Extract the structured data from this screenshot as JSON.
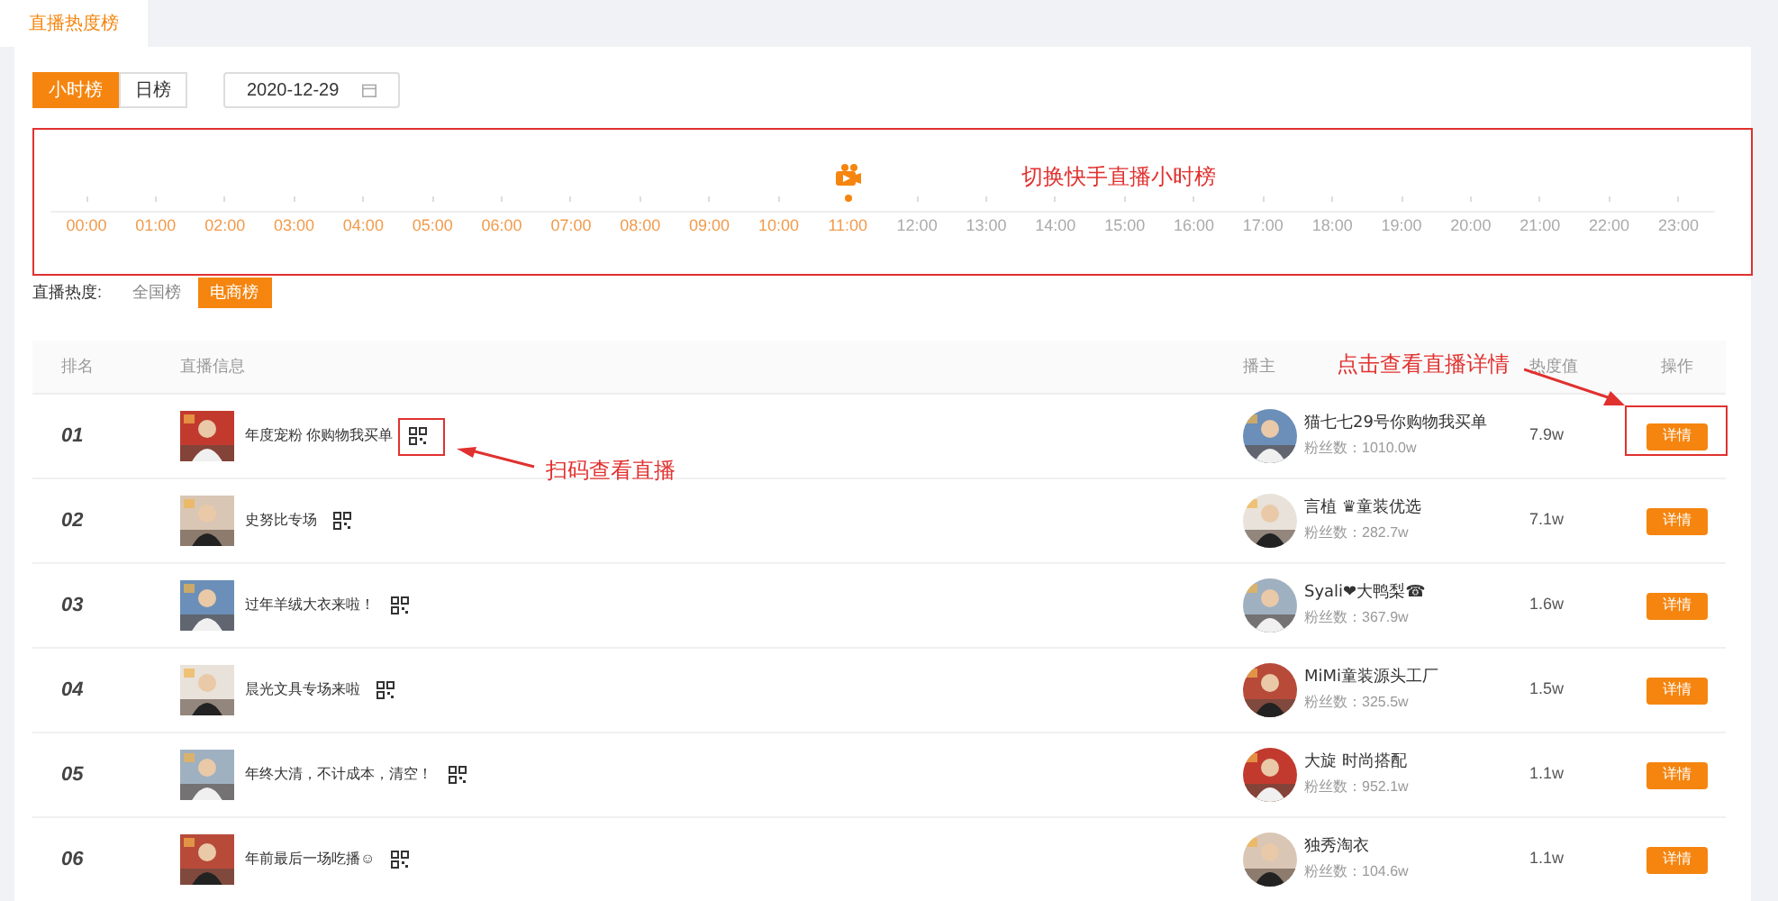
{
  "page_tab": {
    "label": "直播热度榜",
    "selected": true
  },
  "period_tabs": [
    {
      "label": "小时榜",
      "selected": true
    },
    {
      "label": "日榜",
      "selected": false
    }
  ],
  "date_field": {
    "value": "2020-12-29"
  },
  "timeline": [
    {
      "label": "00:00",
      "available": true,
      "selected": false
    },
    {
      "label": "01:00",
      "available": true,
      "selected": false
    },
    {
      "label": "02:00",
      "available": true,
      "selected": false
    },
    {
      "label": "03:00",
      "available": true,
      "selected": false
    },
    {
      "label": "04:00",
      "available": true,
      "selected": false
    },
    {
      "label": "05:00",
      "available": true,
      "selected": false
    },
    {
      "label": "06:00",
      "available": true,
      "selected": false
    },
    {
      "label": "07:00",
      "available": true,
      "selected": false
    },
    {
      "label": "08:00",
      "available": true,
      "selected": false
    },
    {
      "label": "09:00",
      "available": true,
      "selected": false
    },
    {
      "label": "10:00",
      "available": true,
      "selected": false
    },
    {
      "label": "11:00",
      "available": true,
      "selected": true
    },
    {
      "label": "12:00",
      "available": false,
      "selected": false
    },
    {
      "label": "13:00",
      "available": false,
      "selected": false
    },
    {
      "label": "14:00",
      "available": false,
      "selected": false
    },
    {
      "label": "15:00",
      "available": false,
      "selected": false
    },
    {
      "label": "16:00",
      "available": false,
      "selected": false
    },
    {
      "label": "17:00",
      "available": false,
      "selected": false
    },
    {
      "label": "18:00",
      "available": false,
      "selected": false
    },
    {
      "label": "19:00",
      "available": false,
      "selected": false
    },
    {
      "label": "20:00",
      "available": false,
      "selected": false
    },
    {
      "label": "21:00",
      "available": false,
      "selected": false
    },
    {
      "label": "22:00",
      "available": false,
      "selected": false
    },
    {
      "label": "23:00",
      "available": false,
      "selected": false
    }
  ],
  "heat_filter": {
    "label": "直播热度:",
    "options": [
      {
        "label": "全国榜",
        "selected": false
      },
      {
        "label": "电商榜",
        "selected": true
      }
    ]
  },
  "table": {
    "columns": [
      "排名",
      "直播信息",
      "播主",
      "热度值",
      "操作"
    ],
    "rows": [
      {
        "rank": "01",
        "title": "年度宠粉 你购物我买单",
        "anchor": "猫七七29号你购物我买单",
        "fans": "粉丝数：1010.0w",
        "heat": "7.9w",
        "action": "详情"
      },
      {
        "rank": "02",
        "title": "史努比专场",
        "anchor": "言植 ♛童装优选",
        "fans": "粉丝数：282.7w",
        "heat": "7.1w",
        "action": "详情"
      },
      {
        "rank": "03",
        "title": "过年羊绒大衣来啦！",
        "anchor": "Syali❤大鸭梨☎",
        "fans": "粉丝数：367.9w",
        "heat": "1.6w",
        "action": "详情"
      },
      {
        "rank": "04",
        "title": "晨光文具专场来啦",
        "anchor": "MiMi童装源头工厂",
        "fans": "粉丝数：325.5w",
        "heat": "1.5w",
        "action": "详情"
      },
      {
        "rank": "05",
        "title": "年终大清，不计成本，清空！",
        "anchor": "大旋 时尚搭配",
        "fans": "粉丝数：952.1w",
        "heat": "1.1w",
        "action": "详情"
      },
      {
        "rank": "06",
        "title": "年前最后一场吃播☺",
        "anchor": "独秀淘衣",
        "fans": "粉丝数：104.6w",
        "heat": "1.1w",
        "action": "详情"
      }
    ]
  },
  "annotations": [
    {
      "text": "切换快手直播小时榜"
    },
    {
      "text": "扫码查看直播"
    },
    {
      "text": "点击查看直播详情"
    }
  ]
}
